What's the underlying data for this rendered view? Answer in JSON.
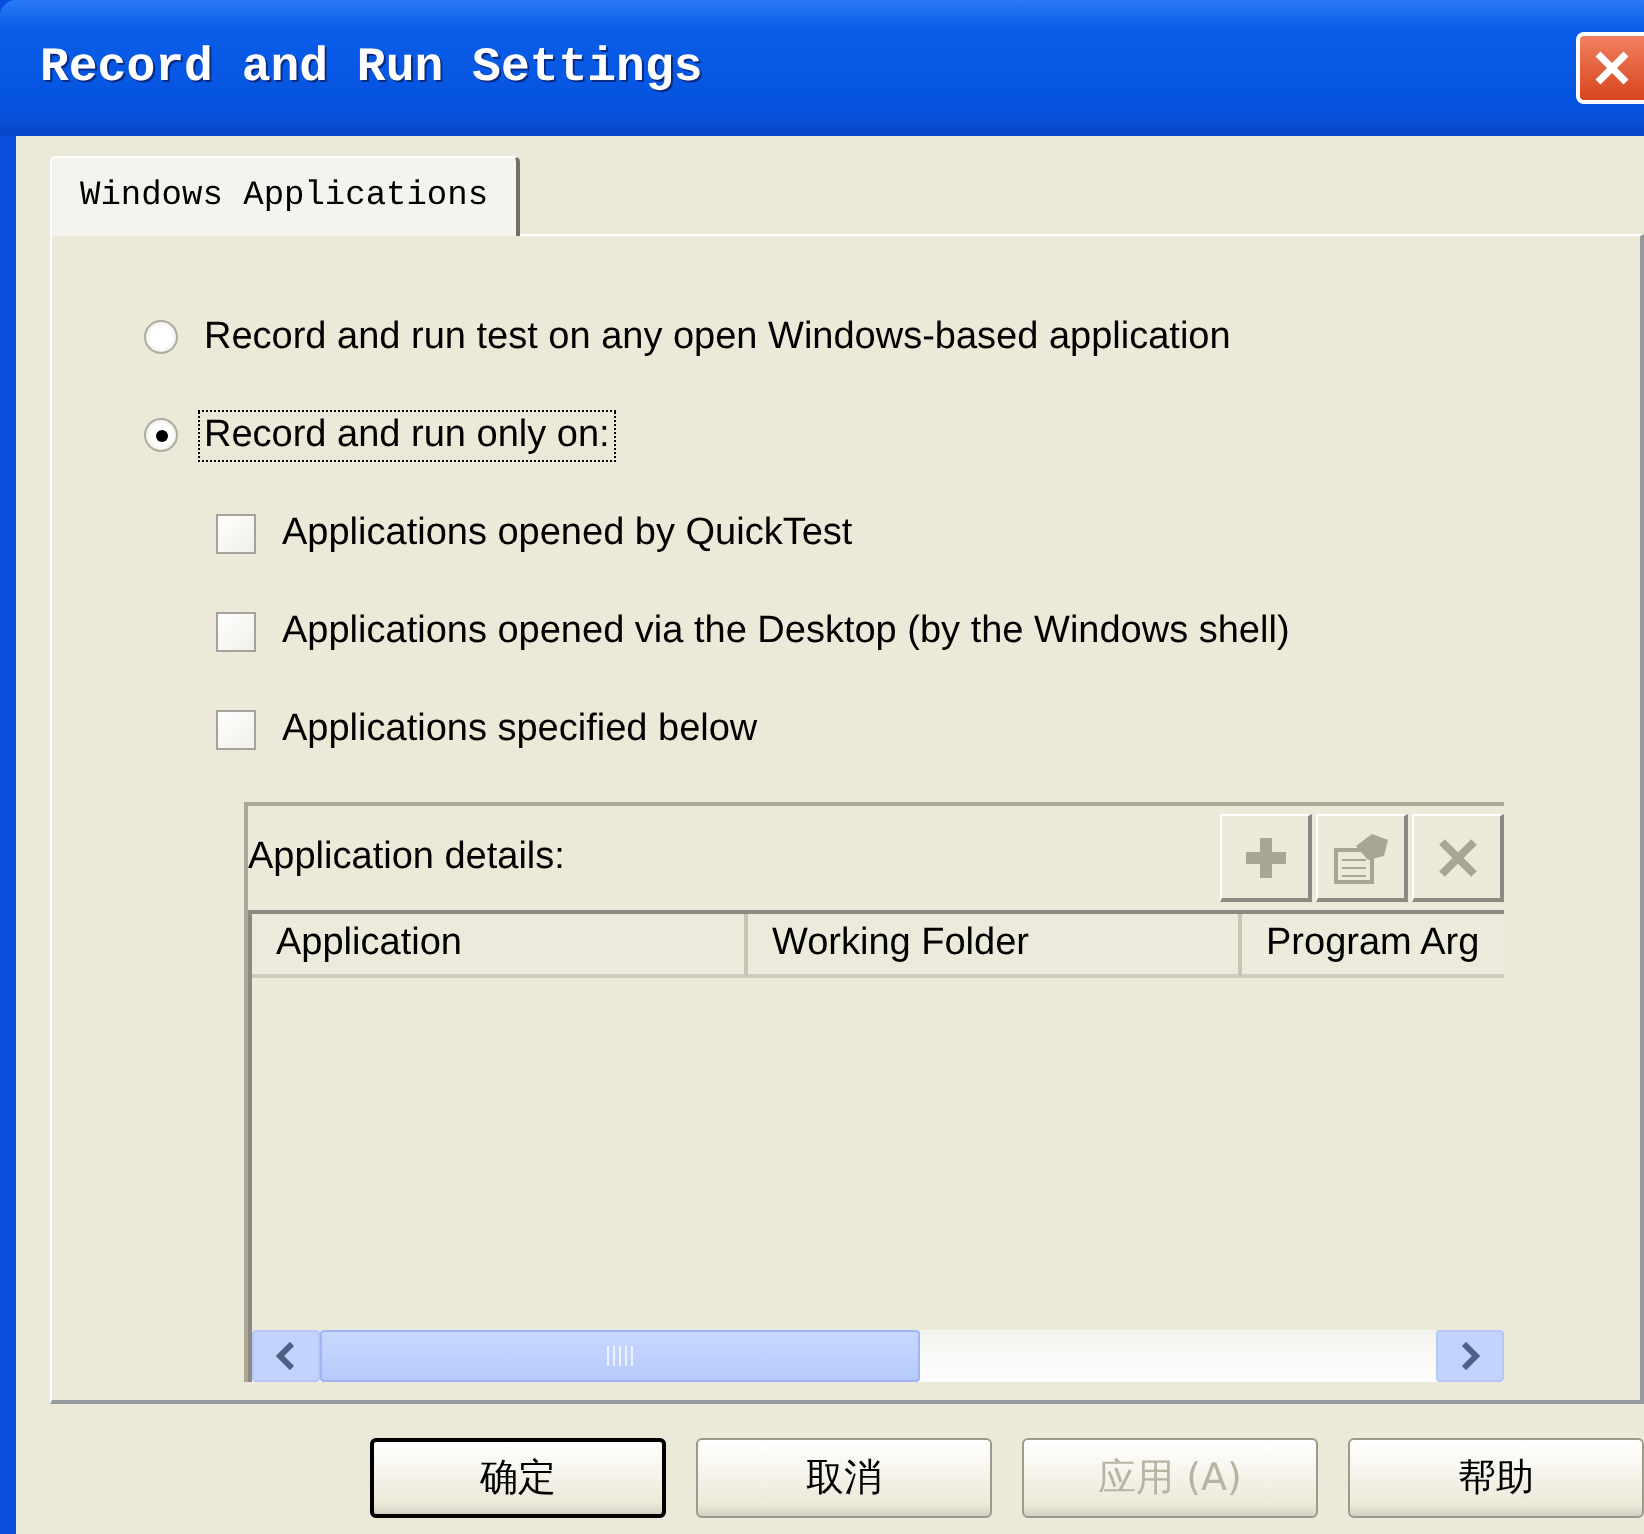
{
  "window": {
    "title": "Record and Run Settings"
  },
  "tabs": [
    {
      "label": "Windows Applications",
      "selected": true
    }
  ],
  "radios": [
    {
      "label": "Record and run test on any open Windows-based application",
      "selected": false,
      "focused": false
    },
    {
      "label": "Record and run only on:",
      "selected": true,
      "focused": true
    }
  ],
  "checkboxes": [
    {
      "label": "Applications opened by QuickTest",
      "checked": false
    },
    {
      "label": "Applications opened via the Desktop (by the Windows shell)",
      "checked": false
    },
    {
      "label": "Applications specified below",
      "checked": false
    }
  ],
  "application_details": {
    "label": "Application details:",
    "toolbar_buttons": [
      {
        "kind": "add",
        "disabled": true
      },
      {
        "kind": "edit",
        "disabled": true
      },
      {
        "kind": "delete",
        "disabled": true
      }
    ],
    "columns": [
      "Application",
      "Working Folder",
      "Program Arg"
    ]
  },
  "buttons": [
    {
      "label": "确定",
      "default": true,
      "disabled": false
    },
    {
      "label": "取消",
      "default": false,
      "disabled": false
    },
    {
      "label": "应用 (A)",
      "default": false,
      "disabled": true
    },
    {
      "label": "帮助",
      "default": false,
      "disabled": false
    }
  ]
}
